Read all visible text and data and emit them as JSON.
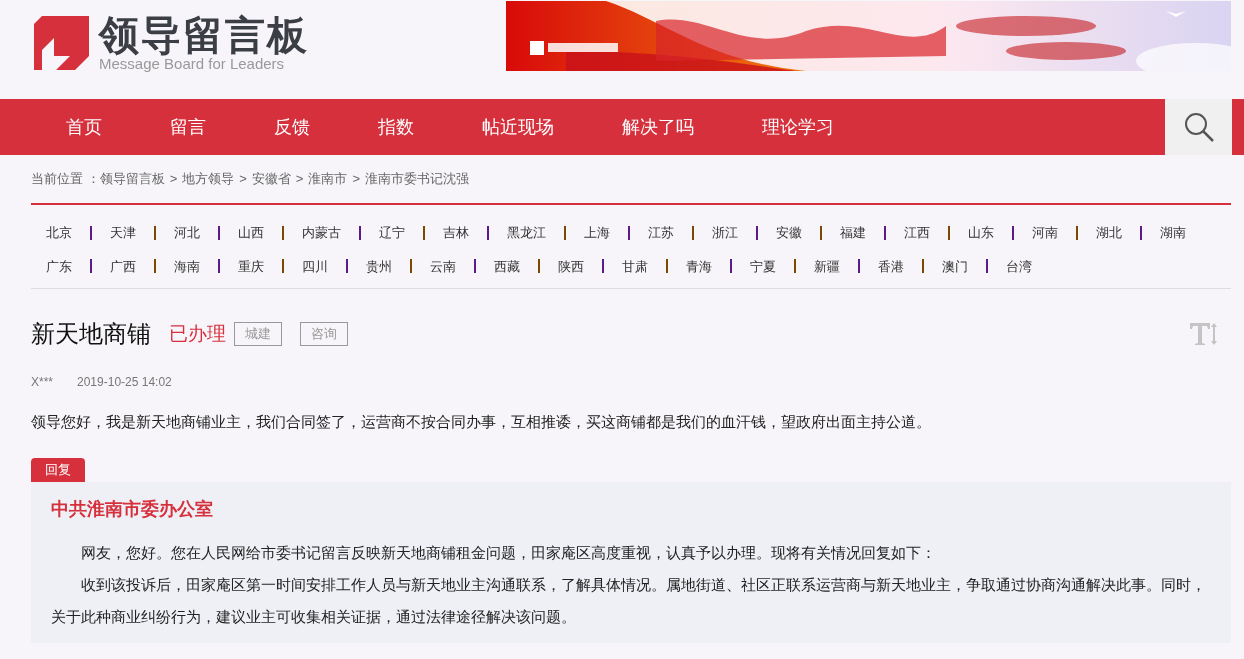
{
  "header": {
    "logo_title": "领导留言板",
    "logo_subtitle": "Message Board for Leaders"
  },
  "nav": {
    "items": [
      {
        "label": "首页"
      },
      {
        "label": "留言"
      },
      {
        "label": "反馈"
      },
      {
        "label": "指数"
      },
      {
        "label": "帖近现场"
      },
      {
        "label": "解决了吗"
      },
      {
        "label": "理论学习"
      }
    ]
  },
  "breadcrumb": {
    "prefix": "当前位置 ：",
    "items": [
      "领导留言板",
      "地方领导",
      "安徽省",
      "淮南市",
      "淮南市委书记沈强"
    ],
    "separator": ">"
  },
  "regions": [
    [
      "北京",
      "天津",
      "河北",
      "山西",
      "内蒙古",
      "辽宁",
      "吉林",
      "黑龙江",
      "上海",
      "江苏",
      "浙江",
      "安徽",
      "福建",
      "江西",
      "山东",
      "河南",
      "湖北",
      "湖南"
    ],
    [
      "广东",
      "广西",
      "海南",
      "重庆",
      "四川",
      "贵州",
      "云南",
      "西藏",
      "陕西",
      "甘肃",
      "青海",
      "宁夏",
      "新疆",
      "香港",
      "澳门",
      "台湾"
    ]
  ],
  "message": {
    "title": "新天地商铺",
    "status": "已办理",
    "tags": [
      "城建",
      "咨询"
    ],
    "author": "X***",
    "time": "2019-10-25 14:02",
    "body": "领导您好，我是新天地商铺业主，我们合同签了，运营商不按合同办事，互相推诿，买这商铺都是我们的血汗钱，望政府出面主持公道。"
  },
  "reply": {
    "badge": "回复",
    "org": "中共淮南市委办公室",
    "paragraphs": [
      "网友，您好。您在人民网给市委书记留言反映新天地商铺租金问题，田家庵区高度重视，认真予以办理。现将有关情况回复如下：",
      "收到该投诉后，田家庵区第一时间安排工作人员与新天地业主沟通联系，了解具体情况。属地街道、社区正联系运营商与新天地业主，争取通过协商沟通解决此事。同时，关于此种商业纠纷行为，建议业主可收集相关证据，通过法律途径解决该问题。"
    ]
  }
}
